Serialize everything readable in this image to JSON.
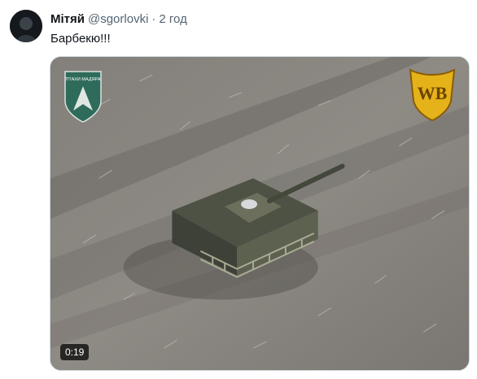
{
  "tweet": {
    "author_name": "Мітяй",
    "handle": "@sgorlovki",
    "separator": "·",
    "time": "2 год",
    "text": "Барбекю!!!"
  },
  "media": {
    "type": "video",
    "duration": "0:19",
    "logo_left_text": "ПТАХИ МАДЯРА",
    "logo_right_text": "WB",
    "icon_left": "shield-emblem-icon",
    "icon_right": "wb-shield-icon"
  },
  "colors": {
    "name": "#0f1419",
    "secondary_text": "#536471",
    "media_border": "#cfd9de",
    "field": "#7d7a75",
    "emblem_green": "#2f6b5a",
    "wb_gold": "#e5b21a"
  }
}
